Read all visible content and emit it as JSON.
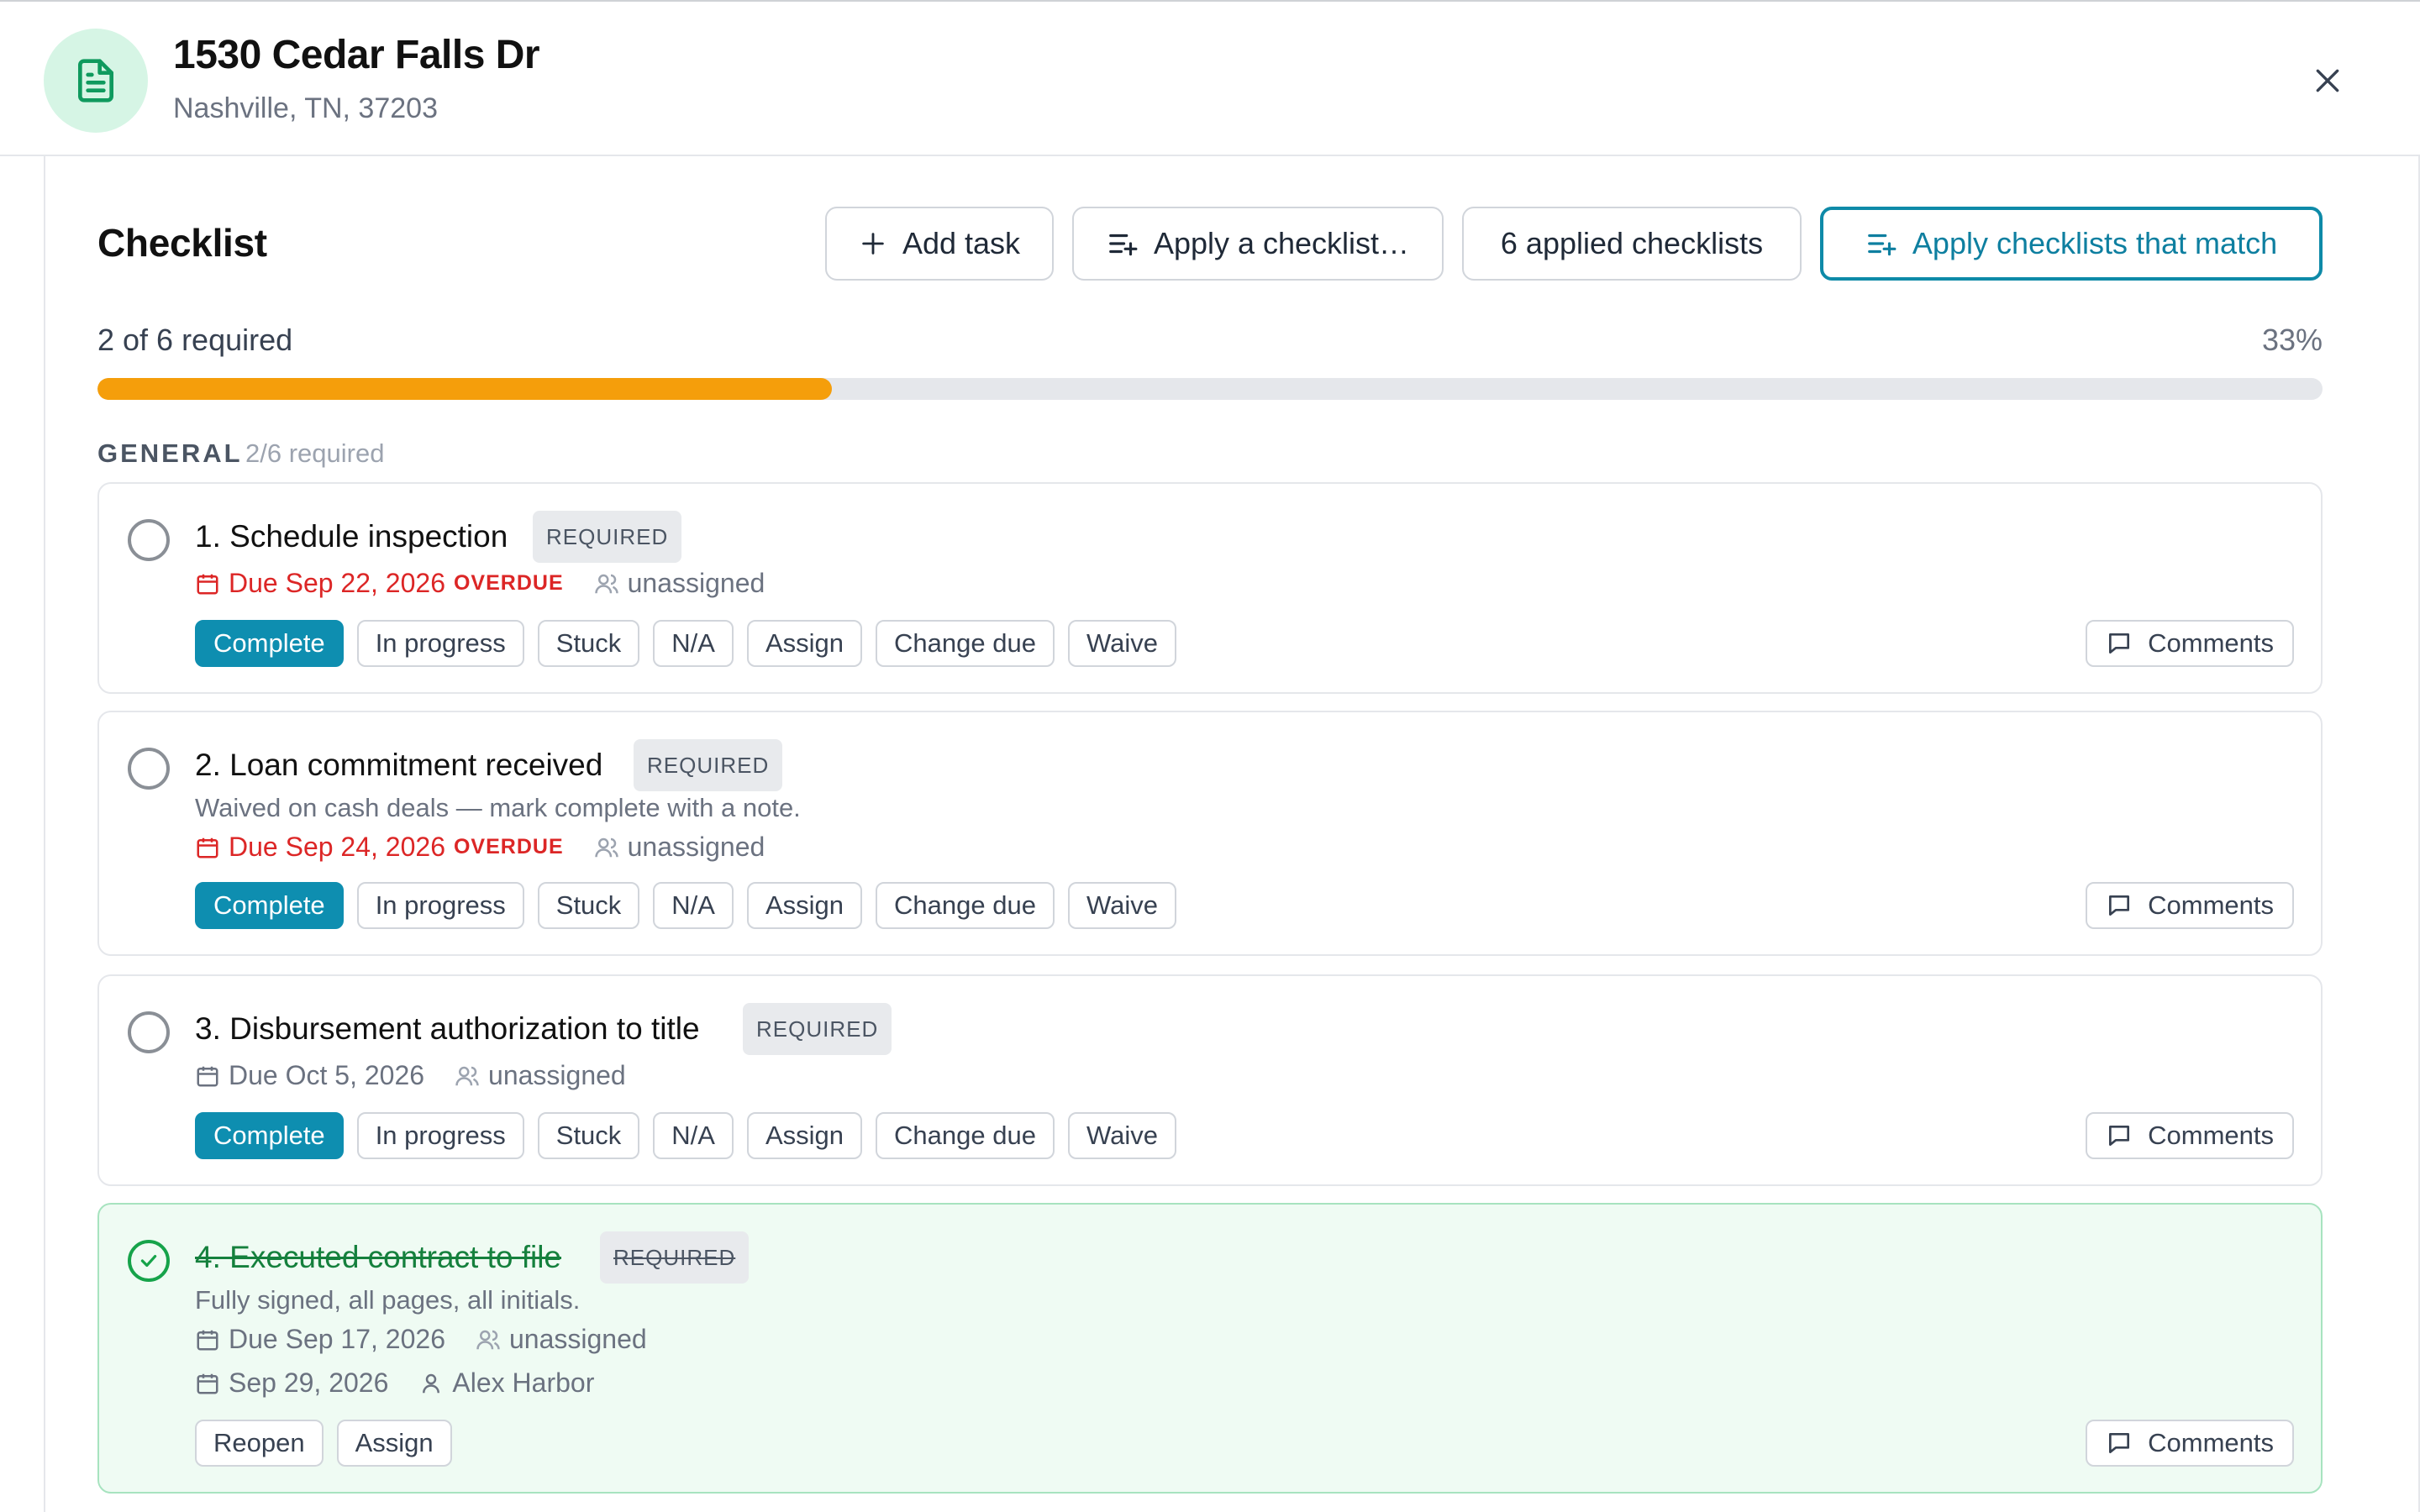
{
  "header": {
    "title": "1530 Cedar Falls Dr",
    "subtitle": "Nashville, TN, 37203",
    "icon": "document-icon",
    "accent": "#d6f5e5"
  },
  "checklist": {
    "title": "Checklist",
    "buttons": {
      "add_task": "Add task",
      "apply_checklist": "Apply a checklist…",
      "applied": "6 applied checklists",
      "apply_matching": "Apply checklists that match"
    },
    "progress": {
      "label": "2 of 6 required",
      "percent_label": "33%",
      "fraction": 0.33,
      "color": "#f59e0b"
    },
    "section": {
      "label": "GENERAL",
      "count": "2/6 required"
    },
    "tasks": [
      {
        "title": "1. Schedule inspection",
        "badge": "REQUIRED",
        "due": "Due Sep 22, 2026",
        "overdue": "OVERDUE",
        "assignee": "unassigned",
        "actions": [
          "Complete",
          "In progress",
          "Stuck",
          "N/A",
          "Assign",
          "Change due",
          "Waive"
        ],
        "comments": "Comments"
      },
      {
        "title": "2. Loan commitment received",
        "badge": "REQUIRED",
        "note": "Waived on cash deals — mark complete with a note.",
        "due": "Due Sep 24, 2026",
        "overdue": "OVERDUE",
        "assignee": "unassigned",
        "actions": [
          "Complete",
          "In progress",
          "Stuck",
          "N/A",
          "Assign",
          "Change due",
          "Waive"
        ],
        "comments": "Comments"
      },
      {
        "title": "3. Disbursement authorization to title",
        "badge": "REQUIRED",
        "due": "Due Oct 5, 2026",
        "assignee": "unassigned",
        "actions": [
          "Complete",
          "In progress",
          "Stuck",
          "N/A",
          "Assign",
          "Change due",
          "Waive"
        ],
        "comments": "Comments"
      },
      {
        "title": "4. Executed contract to file",
        "badge": "REQUIRED",
        "note": "Fully signed, all pages, all initials.",
        "due": "Due Sep 17, 2026",
        "assignee": "unassigned",
        "completed_date": "Sep 29, 2026",
        "completed_by": "Alex Harbor",
        "actions": [
          "Reopen",
          "Assign"
        ],
        "comments": "Comments"
      }
    ]
  },
  "colors": {
    "primary": "#0e8eb0",
    "overdue": "#dc2626",
    "done_bg": "#effbf3",
    "done_text": "#15803d"
  }
}
